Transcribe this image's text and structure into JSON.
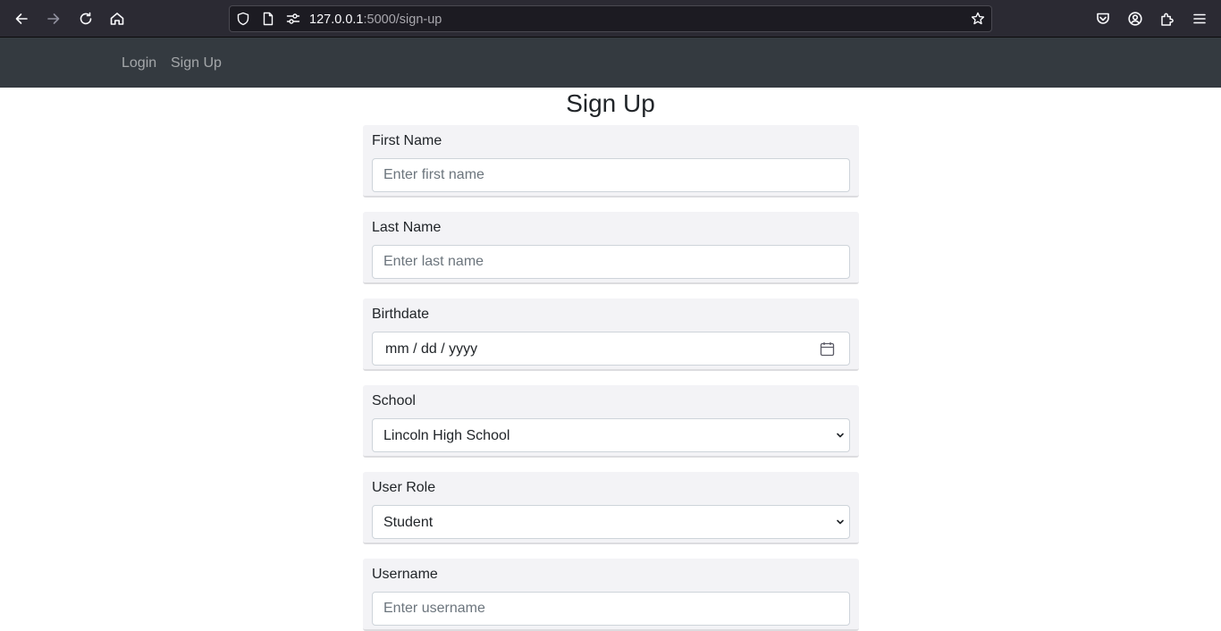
{
  "browser": {
    "url_host": "127.0.0.1",
    "url_path": ":5000/sign-up"
  },
  "navbar": {
    "links": [
      {
        "label": "Login"
      },
      {
        "label": "Sign Up"
      }
    ]
  },
  "page": {
    "title": "Sign Up"
  },
  "form": {
    "first_name": {
      "label": "First Name",
      "placeholder": "Enter first name"
    },
    "last_name": {
      "label": "Last Name",
      "placeholder": "Enter last name"
    },
    "birthdate": {
      "label": "Birthdate",
      "format_hint": "mm / dd / yyyy"
    },
    "school": {
      "label": "School",
      "selected": "Lincoln High School"
    },
    "user_role": {
      "label": "User Role",
      "selected": "Student"
    },
    "username": {
      "label": "Username",
      "placeholder": "Enter username"
    }
  },
  "colors": {
    "browser_toolbar": "#2b2a33",
    "navbar": "#343a40",
    "form_group_bg": "#f3f3f6"
  },
  "icons": {
    "toolbar": [
      "back-arrow-icon",
      "forward-arrow-icon",
      "reload-icon",
      "home-icon"
    ],
    "urlbar": [
      "shield-icon",
      "page-icon",
      "permissions-icon",
      "bookmark-star-icon"
    ],
    "right": [
      "pocket-icon",
      "account-icon",
      "extensions-icon",
      "menu-icon"
    ],
    "form": [
      "calendar-icon",
      "chevron-down-icon"
    ]
  }
}
